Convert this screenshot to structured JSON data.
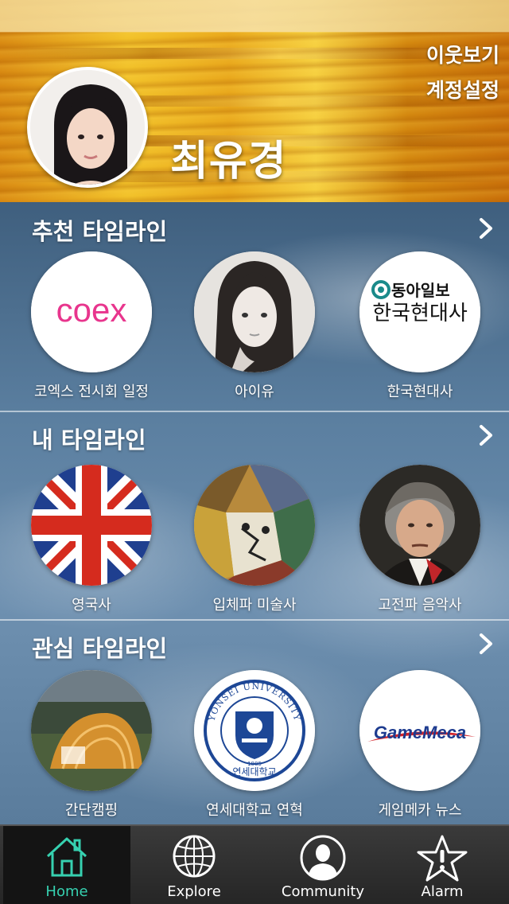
{
  "header": {
    "neighbors_label": "이웃보기",
    "settings_label": "계정설정",
    "user_name": "최유경"
  },
  "sections": [
    {
      "title": "추천 타임라인",
      "items": [
        {
          "label": "코엑스 전시회 일정",
          "logo_text": "coex"
        },
        {
          "label": "아이유"
        },
        {
          "label": "한국현대사",
          "logo_line1": "동아일보",
          "logo_line2": "한국현대사"
        }
      ]
    },
    {
      "title": "내 타임라인",
      "items": [
        {
          "label": "영국사"
        },
        {
          "label": "입체파 미술사"
        },
        {
          "label": "고전파 음악사"
        }
      ]
    },
    {
      "title": "관심 타임라인",
      "items": [
        {
          "label": "간단캠핑"
        },
        {
          "label": "연세대학교 연혁",
          "logo_text": "YONSEI UNIVERSITY",
          "logo_sub": "연세대학교",
          "logo_year": "1885"
        },
        {
          "label": "게임메카 뉴스",
          "logo_text": "GameMeca"
        }
      ]
    }
  ],
  "tabbar": {
    "tabs": [
      {
        "label": "Home",
        "icon": "home-icon",
        "active": true
      },
      {
        "label": "Explore",
        "icon": "globe-icon",
        "active": false
      },
      {
        "label": "Community",
        "icon": "person-icon",
        "active": false
      },
      {
        "label": "Alarm",
        "icon": "alert-star-icon",
        "active": false
      }
    ]
  },
  "colors": {
    "active_tab_text": "#36d1b0",
    "coex_pink": "#e8358d",
    "gamemeca_blue": "#1d3b8f",
    "gamemeca_red": "#d3232a",
    "yonsei_blue": "#1d4796"
  }
}
